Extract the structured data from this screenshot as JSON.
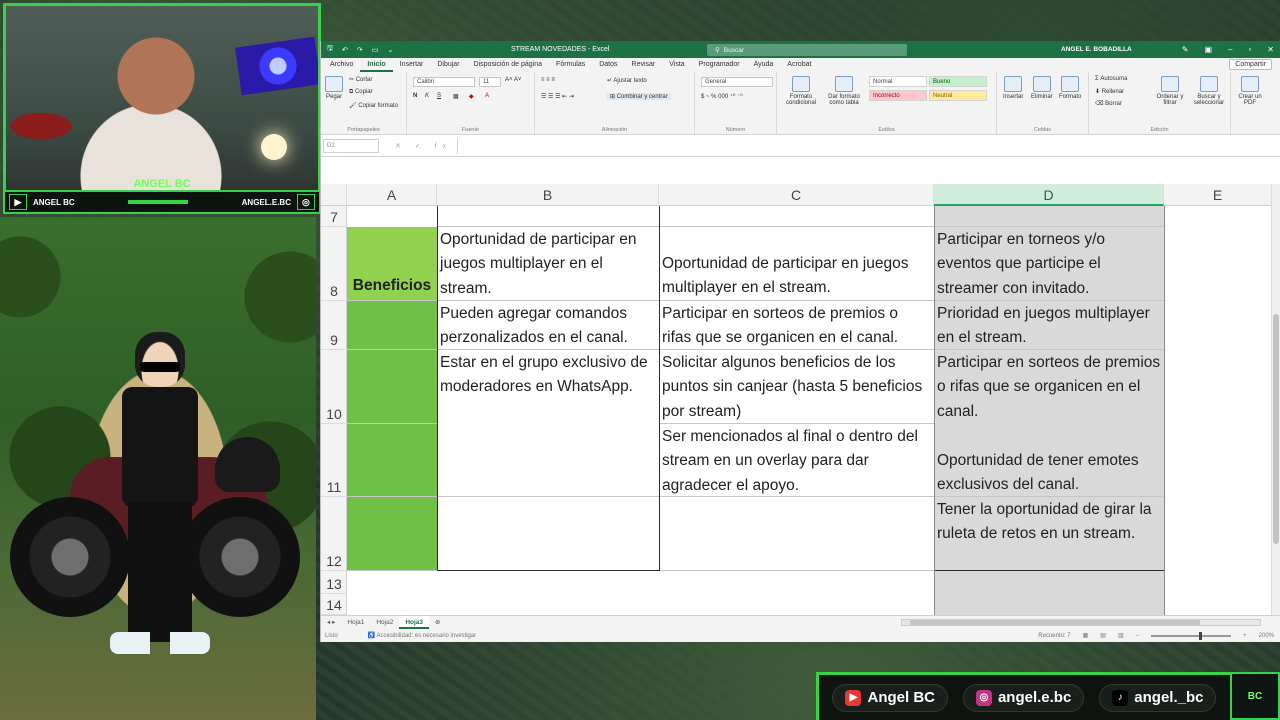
{
  "overlay": {
    "cam_name": "ANGEL BC",
    "youtube_label": "ANGEL BC",
    "instagram_label": "ANGEL.E.BC",
    "socials": [
      {
        "platform": "youtube",
        "handle": "Angel BC",
        "color": "#e53935"
      },
      {
        "platform": "instagram",
        "handle": "angel.e.bc",
        "color": "#c13584"
      },
      {
        "platform": "tiktok",
        "handle": "angel._bc",
        "color": "#111111"
      }
    ],
    "logo_text": "BC",
    "accent": "#35d24a"
  },
  "excel": {
    "title": "STREAM NOVEDADES - Excel",
    "search_placeholder": "Buscar",
    "user": "ANGEL E. BOBADILLA",
    "menu": [
      "Archivo",
      "Inicio",
      "Insertar",
      "Dibujar",
      "Disposición de página",
      "Fórmulas",
      "Datos",
      "Revisar",
      "Vista",
      "Programador",
      "Ayuda",
      "Acrobat"
    ],
    "active_menu": "Inicio",
    "share": "Compartir",
    "ribbon": {
      "paste": "Pegar",
      "cut": "Cortar",
      "copy": "Copiar",
      "format_painter": "Copiar formato",
      "clipboard": "Portapapeles",
      "font_name": "Calibri",
      "font_size": "11",
      "font_group": "Fuente",
      "wrap": "Ajustar texto",
      "merge": "Combinar y centrar",
      "align_group": "Alineación",
      "number_format": "General",
      "number_group": "Número",
      "cond_format": "Formato condicional",
      "format_table": "Dar formato como tabla",
      "styles_group": "Estilos",
      "style_normal": "Normal",
      "style_bueno": "Bueno",
      "style_incorrecto": "Incorrecto",
      "style_neutral": "Neutral",
      "insert": "Insertar",
      "delete": "Eliminar",
      "format": "Formato",
      "cells_group": "Celdas",
      "autosum": "Autosuma",
      "fill": "Rellenar",
      "clear": "Borrar",
      "sort": "Ordenar y filtrar",
      "find": "Buscar y seleccionar",
      "edit_group": "Edición",
      "pdf": "Crear un PDF"
    },
    "namebox": "D2",
    "fx": "fx",
    "columns": [
      "A",
      "B",
      "C",
      "D",
      "E"
    ],
    "selected_column": "D",
    "rows": [
      {
        "num": "7",
        "A": "",
        "B": "",
        "C": "",
        "D": ""
      },
      {
        "num": "8",
        "A": "Beneficios",
        "B": "Oportunidad de participar en juegos multiplayer en el stream.",
        "C": "Oportunidad de participar en juegos multiplayer en el stream.",
        "D": "Participar en torneos y/o eventos que participe el streamer con invitado."
      },
      {
        "num": "9",
        "A": "",
        "B": "Pueden agregar comandos perzonalizados en el canal.",
        "C": "Participar en sorteos de premios o rifas que se organicen en el canal.",
        "D": "Prioridad en juegos multiplayer en el stream."
      },
      {
        "num": "10",
        "A": "",
        "B": "Estar en el grupo exclusivo de moderadores en WhatsApp.",
        "C": "Solicitar algunos beneficios de los puntos sin canjear (hasta 5 beneficios por stream)",
        "D": "Participar en sorteos de premios o rifas que se organicen en el canal."
      },
      {
        "num": "11",
        "A": "",
        "B": "",
        "C": "Ser mencionados al final o dentro del stream en un overlay para dar agradecer el apoyo.",
        "D": "Oportunidad de tener emotes exclusivos del canal."
      },
      {
        "num": "12",
        "A": "",
        "B": "",
        "C": "",
        "D": "Tener la oportunidad de girar la ruleta de retos en un stream."
      },
      {
        "num": "13",
        "A": "",
        "B": "",
        "C": "",
        "D": ""
      },
      {
        "num": "14",
        "A": "",
        "B": "",
        "C": "",
        "D": ""
      }
    ],
    "sheets": [
      "Hoja1",
      "Hoja2",
      "Hoja3"
    ],
    "active_sheet": "Hoja3",
    "status": {
      "ready": "Listo",
      "accessibility": "Accesibilidad: es necesario investigar",
      "count": "Recuento: 7",
      "zoom": "200%"
    }
  }
}
